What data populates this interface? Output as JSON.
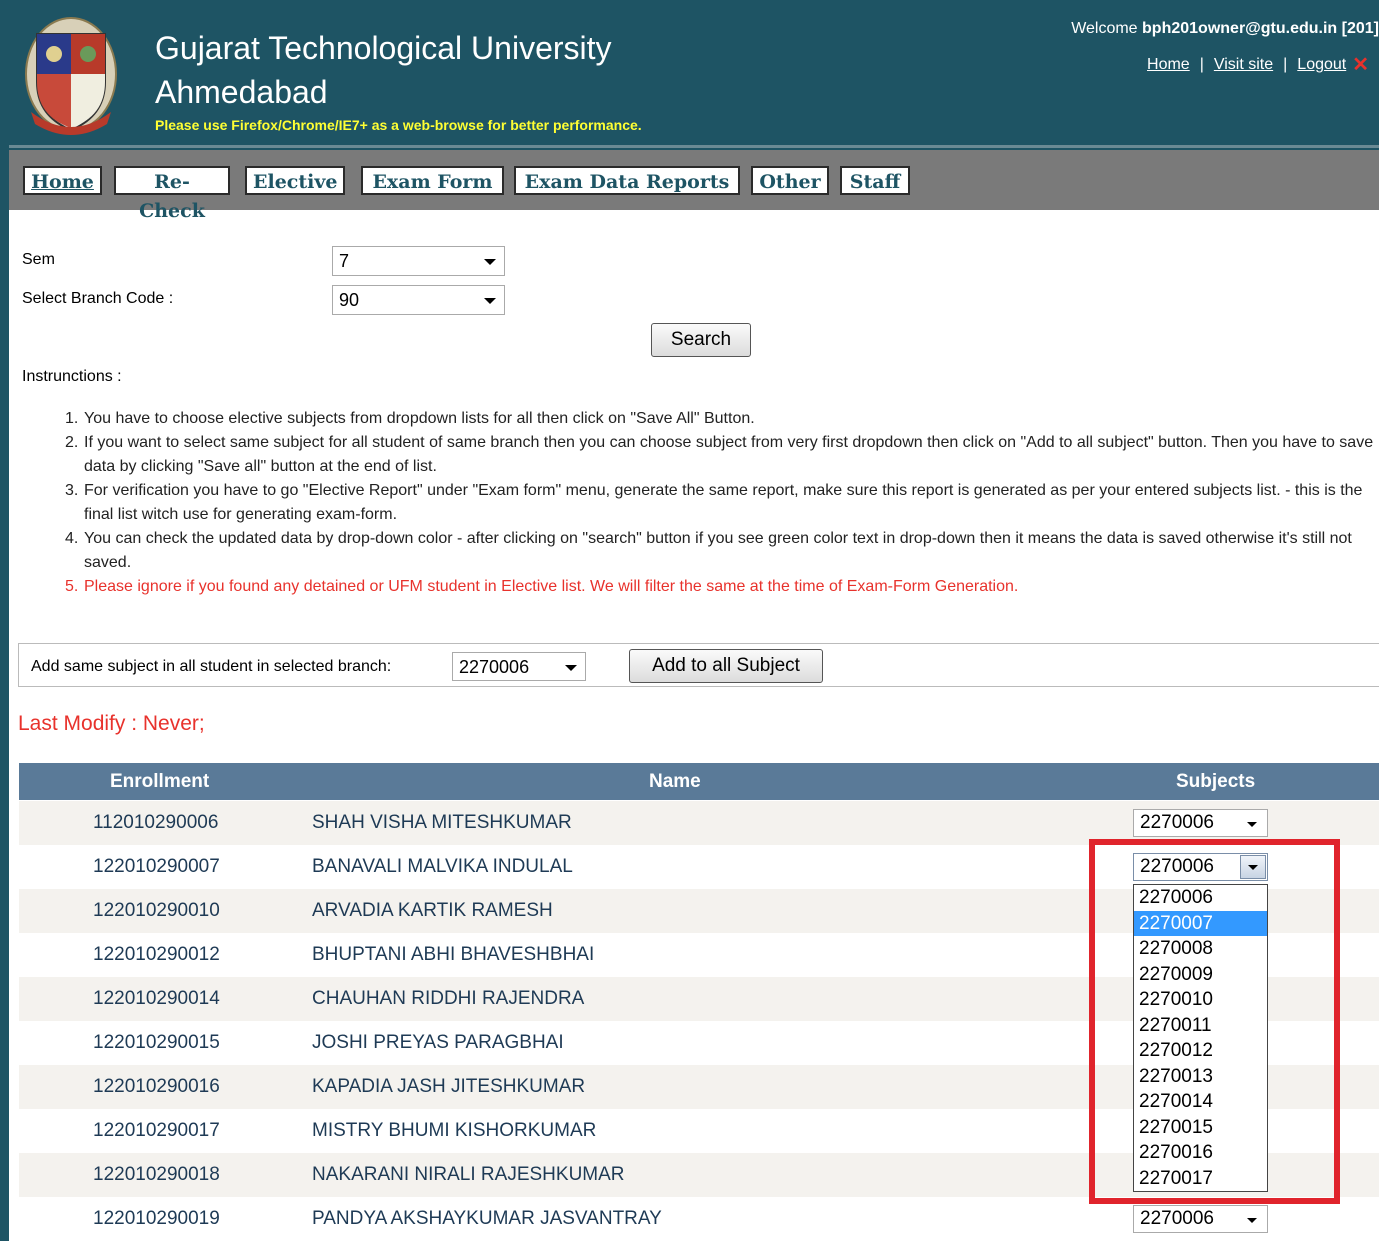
{
  "header": {
    "title_line1": "Gujarat Technological University",
    "title_line2": "Ahmedabad",
    "browser_note": "Please use Firefox/Chrome/IE7+ as a web-browse for better performance.",
    "welcome_prefix": "Welcome ",
    "user": "bph201owner@gtu.edu.in [201]",
    "links": {
      "home": "Home",
      "visit_site": "Visit site",
      "logout": "Logout",
      "separator": "|"
    }
  },
  "menu": {
    "items": [
      "Home",
      "Re-Check",
      "Elective",
      "Exam Form",
      "Exam Data Reports",
      "Other",
      "Staff"
    ]
  },
  "form": {
    "sem_label": "Sem",
    "sem_value": "7",
    "branch_label": "Select Branch Code :",
    "branch_value": "90",
    "search_button": "Search"
  },
  "instructions": {
    "label": "Instrunctions :",
    "items": [
      "You have to choose elective subjects from dropdown lists for all then click on \"Save All\" Button.",
      "If you want to select same subject for all student of same branch then you can choose subject from very first dropdown then click on \"Add to all subject\" button. Then you have to save data by clicking \"Save all\" button at the end of list.",
      "For verification you have to go \"Elective Report\" under \"Exam form\" menu, generate the same report, make sure this report is generated as per your entered subjects list. - this is the final list witch use for generating exam-form.",
      "You can check the updated data by drop-down color - after clicking on \"search\" button if you see green color text in drop-down then it means the data is saved otherwise it's still not saved.",
      "Please ignore if you found any detained or UFM student in Elective list. We will filter the same at the time of Exam-Form Generation."
    ]
  },
  "add_all": {
    "label": "Add same subject in all student in selected branch:",
    "value": "2270006",
    "button": "Add to all Subject"
  },
  "last_modify": "Last Modify : Never;",
  "table": {
    "headers": {
      "enrollment": "Enrollment",
      "name": "Name",
      "subjects": "Subjects"
    },
    "rows": [
      {
        "enrollment": "112010290006",
        "name": "SHAH VISHA MITESHKUMAR",
        "subject": "2270006"
      },
      {
        "enrollment": "122010290007",
        "name": "BANAVALI MALVIKA INDULAL",
        "subject": "2270006"
      },
      {
        "enrollment": "122010290010",
        "name": "ARVADIA KARTIK RAMESH",
        "subject": ""
      },
      {
        "enrollment": "122010290012",
        "name": "BHUPTANI ABHI BHAVESHBHAI",
        "subject": ""
      },
      {
        "enrollment": "122010290014",
        "name": "CHAUHAN RIDDHI RAJENDRA",
        "subject": ""
      },
      {
        "enrollment": "122010290015",
        "name": "JOSHI PREYAS PARAGBHAI",
        "subject": ""
      },
      {
        "enrollment": "122010290016",
        "name": "KAPADIA JASH JITESHKUMAR",
        "subject": ""
      },
      {
        "enrollment": "122010290017",
        "name": "MISTRY BHUMI KISHORKUMAR",
        "subject": ""
      },
      {
        "enrollment": "122010290018",
        "name": "NAKARANI NIRALI RAJESHKUMAR",
        "subject": ""
      },
      {
        "enrollment": "122010290019",
        "name": "PANDYA AKSHAYKUMAR JASVANTRAY",
        "subject": "2270006"
      }
    ]
  },
  "open_dropdown": {
    "options": [
      "2270006",
      "2270007",
      "2270008",
      "2270009",
      "2270010",
      "2270011",
      "2270012",
      "2270013",
      "2270014",
      "2270015",
      "2270016",
      "2270017"
    ],
    "highlighted": "2270007"
  },
  "colors": {
    "header_bg": "#1e5464",
    "menu_bg": "#7a7a7a",
    "table_header_bg": "#5a7a98",
    "note_yellow": "#ffff33",
    "alert_red": "#e8322c",
    "highlight_box": "#e0242c",
    "dropdown_highlight": "#3399ff"
  },
  "icons": {
    "logo": "gtu-emblem-logo",
    "logout": "close-x-icon"
  }
}
